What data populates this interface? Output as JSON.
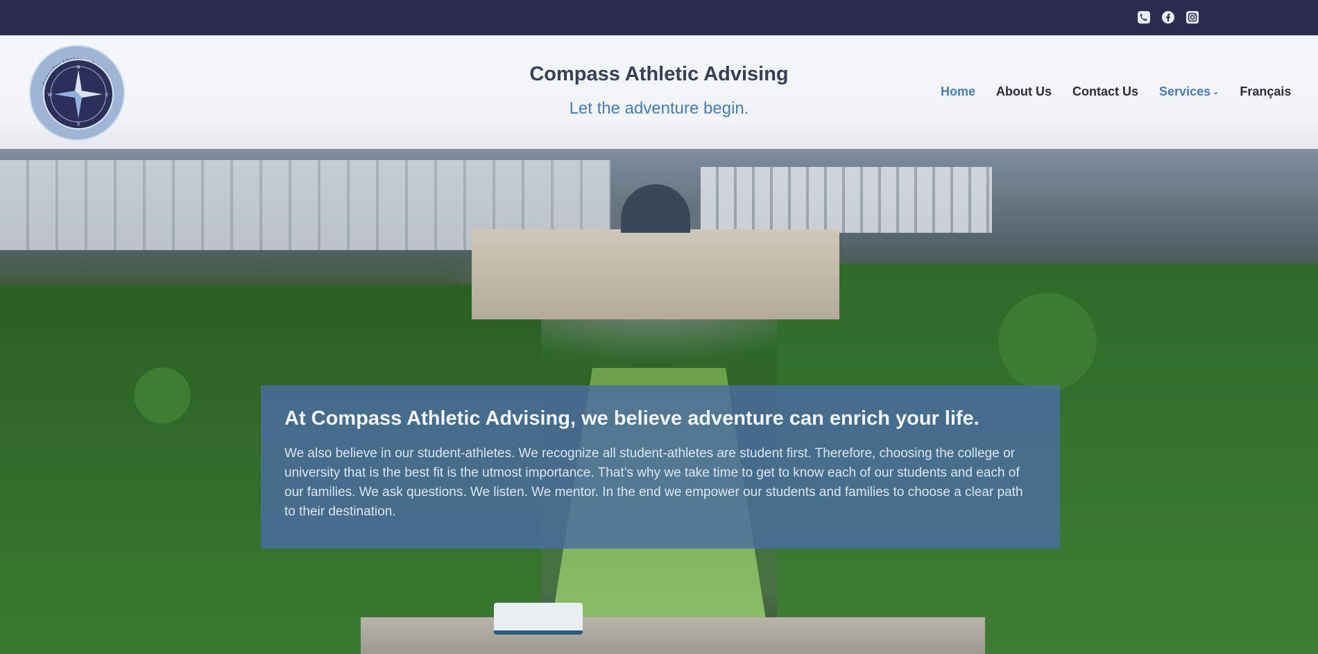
{
  "site": {
    "title": "Compass Athletic Advising",
    "tagline": "Let the adventure begin."
  },
  "logo": {
    "ring_text_top": "Conseiller Athlétique COMPASS",
    "ring_text_bottom": "COMPASS Athletic Advising",
    "compass_letters": [
      "N",
      "E",
      "S",
      "W"
    ]
  },
  "topbar": {
    "social": [
      {
        "icon": "phone-icon",
        "label": "Phone"
      },
      {
        "icon": "facebook-icon",
        "label": "Facebook"
      },
      {
        "icon": "instagram-icon",
        "label": "Instagram"
      }
    ]
  },
  "nav": {
    "items": [
      {
        "label": "Home",
        "active": true
      },
      {
        "label": "About Us"
      },
      {
        "label": "Contact Us"
      },
      {
        "label": "Services",
        "dropdown": true
      },
      {
        "label": "Français"
      }
    ]
  },
  "intro": {
    "heading": "At Compass Athletic Advising, we believe adventure can enrich your life.",
    "body": "We also believe in our student-athletes. We recognize all student-athletes are student first. Therefore, choosing the college or university that is the best fit is the utmost importance. That’s why we take time to get to know each of our students and each of our families. We ask questions. We listen. We mentor. In the end we empower our students and families to choose a clear path to their destination."
  },
  "colors": {
    "topbar": "#2a2b4f",
    "accent": "#4a7bb0",
    "nav_text": "#2a2b3a",
    "intro_panel": "#4a6da0"
  }
}
